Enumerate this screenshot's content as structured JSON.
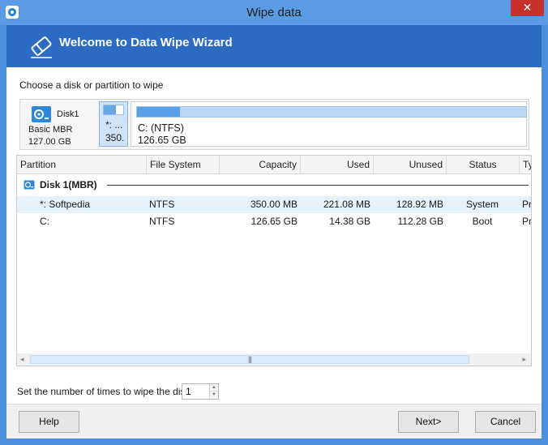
{
  "window": {
    "title": "Wipe data",
    "close_glyph": "✕"
  },
  "banner": {
    "title": "Welcome to Data Wipe Wizard"
  },
  "choose_label": "Choose a disk or partition to wipe",
  "disk_map": {
    "disk": {
      "name": "Disk1",
      "type": "Basic MBR",
      "size": "127.00 GB"
    },
    "partitions": [
      {
        "line1": "*: ...",
        "line2": "350.",
        "used_fraction": 0.63
      },
      {
        "line1": "C: (NTFS)",
        "line2": "126.65 GB",
        "used_fraction": 0.11
      }
    ]
  },
  "table": {
    "columns": [
      "Partition",
      "File System",
      "Capacity",
      "Used",
      "Unused",
      "Status",
      "Ty"
    ],
    "group": {
      "name": "Disk 1(MBR)"
    },
    "rows": [
      {
        "partition": "*: Softpedia",
        "fs": "NTFS",
        "capacity": "350.00 MB",
        "used": "221.08 MB",
        "unused": "128.92 MB",
        "status": "System",
        "type": "Pr"
      },
      {
        "partition": "C:",
        "fs": "NTFS",
        "capacity": "126.65 GB",
        "used": "14.38 GB",
        "unused": "112.28 GB",
        "status": "Boot",
        "type": "Pr"
      }
    ],
    "scrollbar": {
      "left_arrow": "◂",
      "right_arrow": "▸",
      "grip": "|||"
    }
  },
  "wipe_times": {
    "label": "Set the number of times to wipe the disk :",
    "value": "1"
  },
  "buttons": {
    "help": "Help",
    "next": "Next>",
    "cancel": "Cancel"
  },
  "colors": {
    "banner": "#2c6bc4",
    "titlebar": "#5b9be3",
    "close": "#c7312a",
    "selected_row": "#e5f1fb"
  }
}
